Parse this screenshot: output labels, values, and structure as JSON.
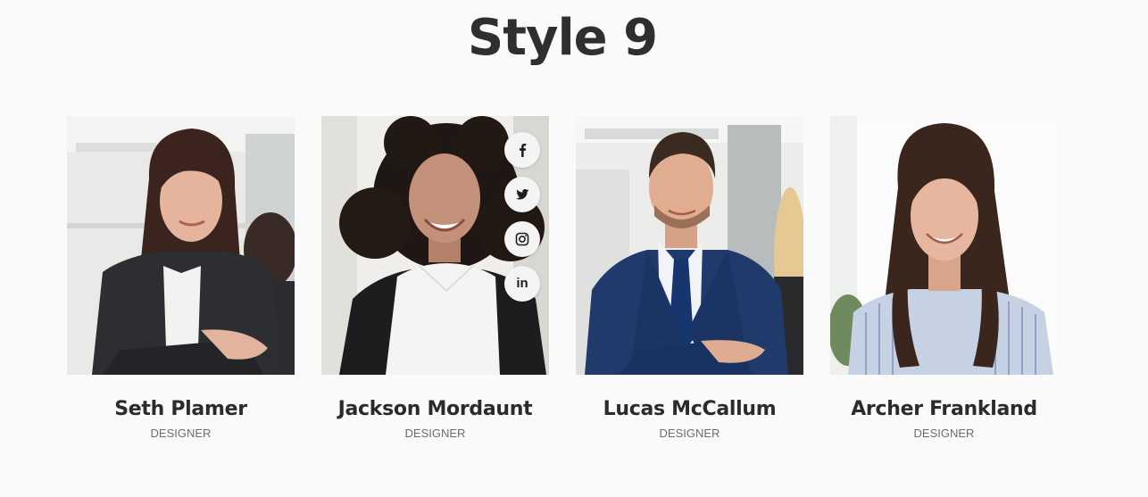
{
  "page": {
    "title": "Style 9"
  },
  "team": [
    {
      "name": "Seth Plamer",
      "role": "DESIGNER"
    },
    {
      "name": "Jackson Mordaunt",
      "role": "DESIGNER"
    },
    {
      "name": "Lucas McCallum",
      "role": "DESIGNER"
    },
    {
      "name": "Archer Frankland",
      "role": "DESIGNER"
    }
  ],
  "social": {
    "icons": [
      "facebook-icon",
      "twitter-icon",
      "instagram-icon",
      "linkedin-icon"
    ],
    "linkedin_glyph": "in"
  },
  "colors": {
    "background": "#fafafa",
    "heading": "#2f2f2f",
    "name": "#2b2b2b",
    "role": "#6d6d6d",
    "social_button": "#f4f4f4",
    "social_icon": "#1e1e1e"
  }
}
